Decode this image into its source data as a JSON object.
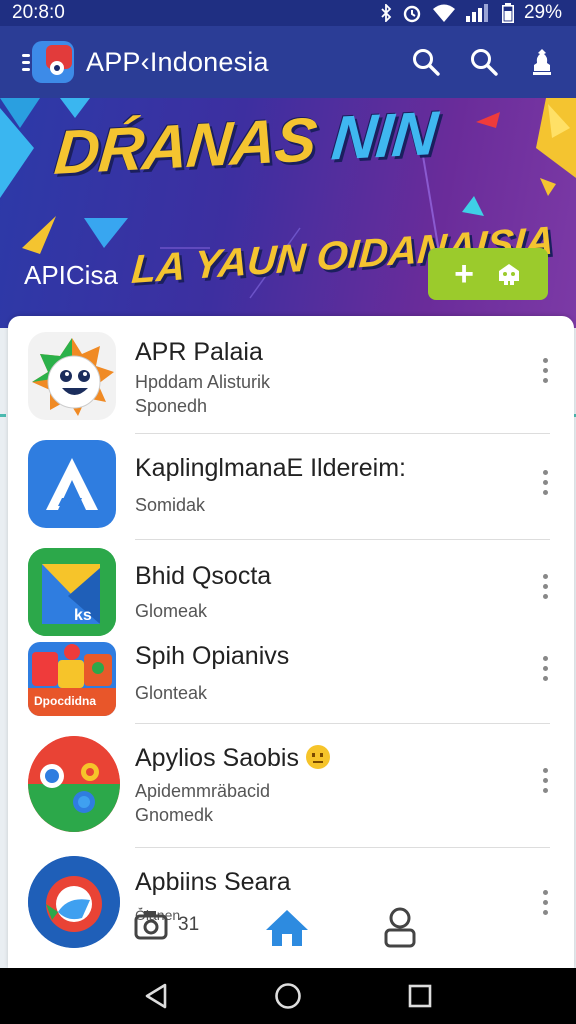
{
  "status_bar": {
    "time": "20:8:0",
    "battery": "29%"
  },
  "app_bar": {
    "title": "APP‹Indonesia"
  },
  "banner": {
    "headline_part1": "DŔANAS ",
    "headline_part2": "NIN",
    "headline_line2": "LA YAUN OIDANAISIA",
    "subtitle": "APICisa"
  },
  "apps": [
    {
      "title": "APR Palaia",
      "line1": "Hpddam Alisturik",
      "line2": "Sponedh",
      "icon": "smiley-app-icon"
    },
    {
      "title": "KaplinglmanaE Ildereim:",
      "line1": "Somidak",
      "line2": "",
      "icon": "letter-a-app-icon"
    },
    {
      "title": "Bhid Qsocta",
      "line1": "Glomeak",
      "line2": "",
      "icon": "folded-map-app-icon"
    },
    {
      "title": "Spih Opianivs",
      "line1": "Glonteak",
      "line2": "",
      "icon": "cards-app-icon",
      "icon_label": "Dpocdidna"
    },
    {
      "title": "Apylios Saobis",
      "line1": "Apidemmräbacid",
      "line2": "Gnomedk",
      "icon": "circle-app-icon"
    },
    {
      "title": "Apbiins Seara",
      "line1": "Ó̆lanen",
      "line2": "",
      "icon": "ring-app-icon"
    }
  ],
  "bottom_tabs": {
    "camera_count": "31"
  },
  "colors": {
    "primary": "#2b3d96",
    "banner_button": "#9bcb2c",
    "headline": "#f4c430",
    "active_tab": "#2d8be0"
  }
}
